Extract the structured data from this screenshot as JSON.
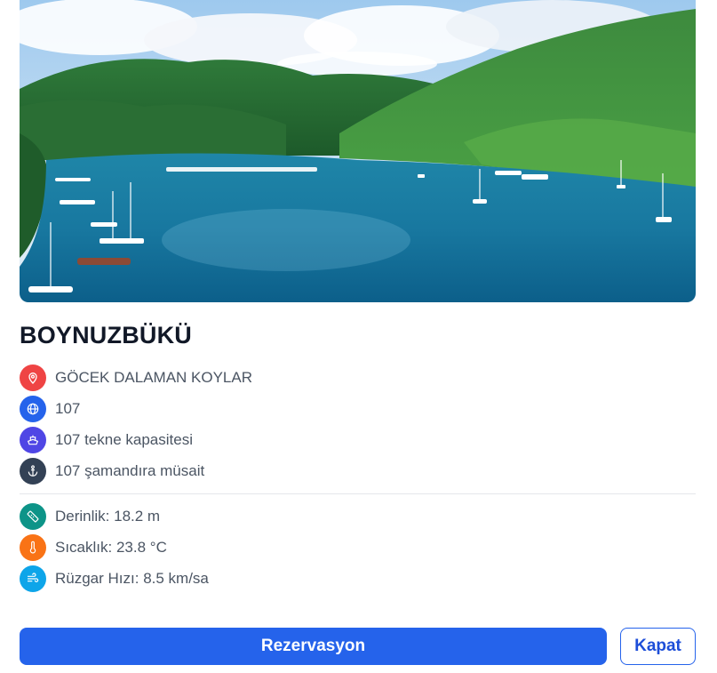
{
  "title": "BOYNUZBÜKÜ",
  "image": {
    "icon": "bay-photo"
  },
  "info": [
    {
      "icon": "location-pin-icon",
      "color": "#ef4444",
      "text": "GÖCEK DALAMAN KOYLAR"
    },
    {
      "icon": "globe-icon",
      "color": "#2563eb",
      "text": "107"
    },
    {
      "icon": "ship-icon",
      "color": "#4f46e5",
      "text": "107 tekne kapasitesi"
    },
    {
      "icon": "anchor-icon",
      "color": "#334155",
      "text": "107 şamandıra müsait"
    }
  ],
  "conditions": [
    {
      "icon": "ruler-icon",
      "color": "#0d9488",
      "text": "Derinlik: 18.2 m"
    },
    {
      "icon": "thermometer-icon",
      "color": "#f97316",
      "text": "Sıcaklık: 23.8 °C"
    },
    {
      "icon": "wind-icon",
      "color": "#0ea5e9",
      "text": "Rüzgar Hızı: 8.5 km/sa"
    }
  ],
  "actions": {
    "primary_label": "Rezervasyon",
    "secondary_label": "Kapat"
  }
}
